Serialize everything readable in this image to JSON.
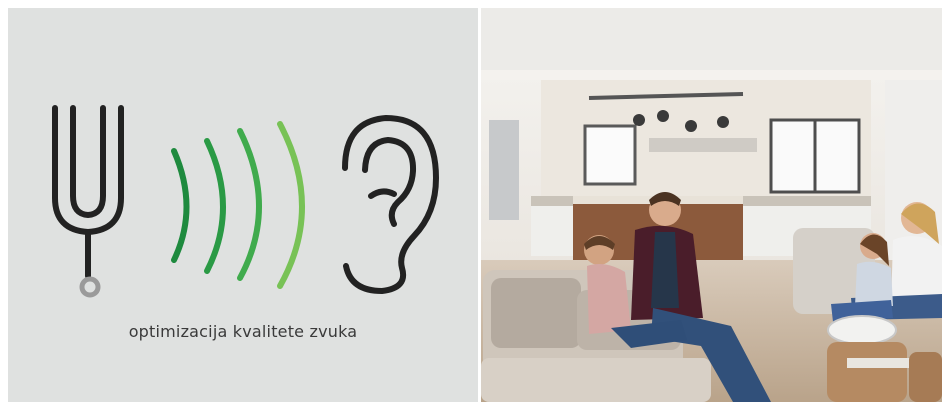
{
  "caption": "optimizacija kvalitete zvuka",
  "colors": {
    "left_panel_bg": "#dfe1e0",
    "icon_stroke": "#222222",
    "wave_1": "#1e8a3e",
    "wave_2": "#2a9a45",
    "wave_3": "#40ab4d",
    "wave_4": "#78c256"
  },
  "icons": [
    "tuning-fork-icon",
    "sound-waves-icon",
    "ear-icon"
  ],
  "photo": {
    "subject": "family-in-living-room-photo"
  }
}
